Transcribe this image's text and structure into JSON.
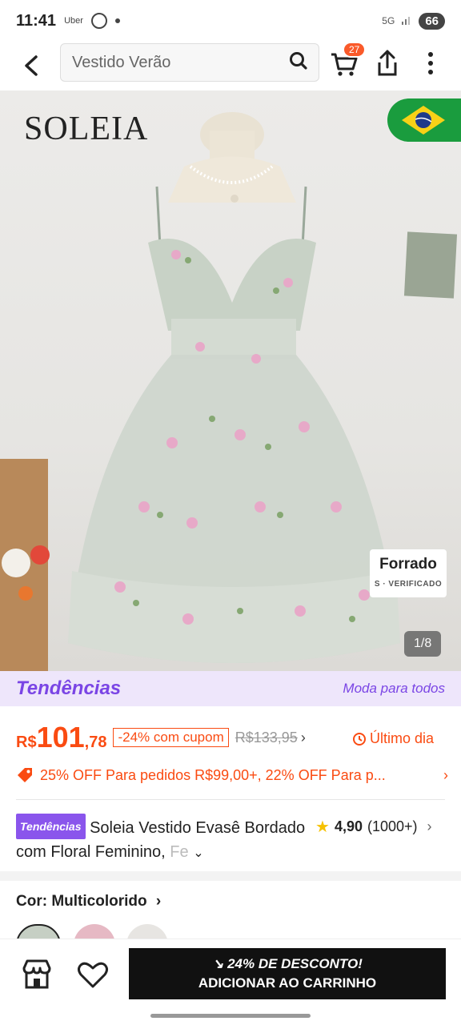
{
  "status": {
    "time": "11:41",
    "apps": "Uber",
    "network": "5G",
    "battery": "66"
  },
  "search": {
    "query": "Vestido Verão"
  },
  "cart": {
    "count": "27"
  },
  "hero": {
    "brand": "SOLEIA",
    "forrado": "Forrado",
    "verified": "S · VERIFICADO",
    "counter": "1/8"
  },
  "trend": {
    "logo": "Tendências",
    "slogan": "Moda para todos"
  },
  "price": {
    "currency": "R$",
    "integer": "101",
    "decimal": ",78",
    "coupon": "-24% com cupom",
    "old": "R$133,95",
    "deadline": "Último dia"
  },
  "promo": {
    "text": "25% OFF Para pedidos R$99,00+,  22% OFF Para p..."
  },
  "product": {
    "badge": "Tendências",
    "title_main": "Soleia Vestido Evasê Bordado com Floral Feminino, ",
    "title_fade": "Fe",
    "rating": "4,90",
    "reviews": "(1000+)"
  },
  "color": {
    "label": "Cor: Multicolorido"
  },
  "cta": {
    "discount": "24% DE DESCONTO!",
    "add": "ADICIONAR AO CARRINHO"
  },
  "colors": {
    "accent": "#fa4b12",
    "trend": "#7a45e5",
    "cta_bg": "#111111"
  }
}
